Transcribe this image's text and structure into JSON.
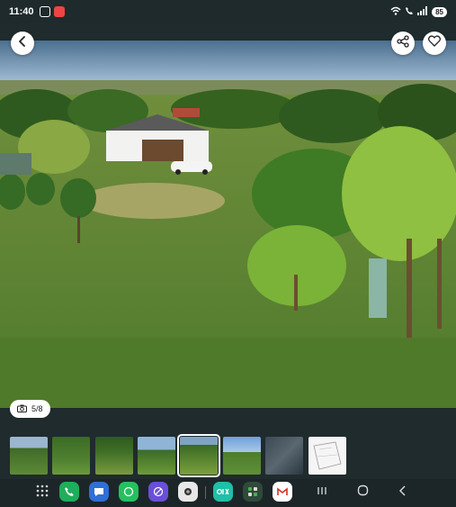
{
  "status_bar": {
    "time": "11:40",
    "battery": "85"
  },
  "gallery": {
    "counter_text": "5/8"
  },
  "icons": {
    "back": "back-arrow-icon",
    "share": "share-icon",
    "favorite": "heart-icon",
    "camera": "camera-icon"
  },
  "colors": {
    "accent": "#ffffff",
    "background": "#1f2b2d"
  }
}
